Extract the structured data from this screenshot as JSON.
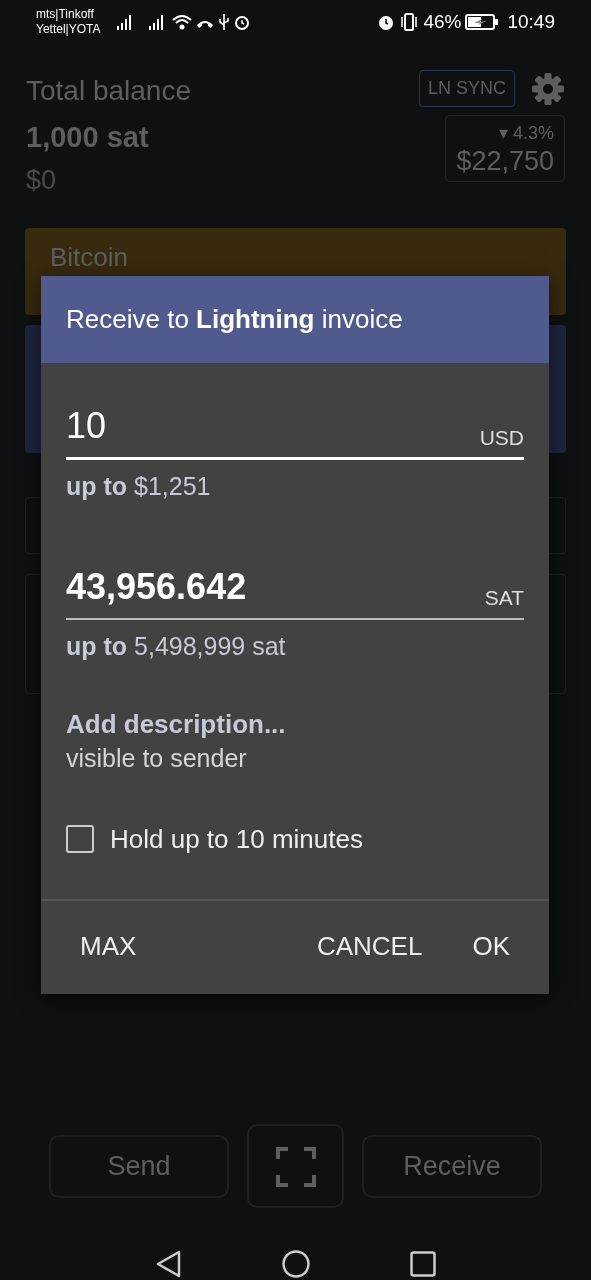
{
  "status_bar": {
    "carriers": [
      "mts|Tinkoff",
      "Yettel|YOTA"
    ],
    "battery": "46%",
    "time": "10:49"
  },
  "header": {
    "title": "Total balance",
    "balance": "1,000 sat",
    "fiat": "$0",
    "sync_button": "LN SYNC",
    "price_change": "▾ 4.3%",
    "price": "$22,750"
  },
  "accounts": [
    {
      "name": "Bitcoin",
      "color": "#382a0e"
    },
    {
      "color": "#1f2540"
    }
  ],
  "dialog": {
    "title": "Receive to **Lightning** invoice",
    "fields": [
      {
        "value": "10",
        "unit": "USD",
        "focused": true,
        "limit": "**up to** $1,251"
      },
      {
        "value": "43,956.642",
        "unit": "SAT",
        "focused": false,
        "limit": "**up to** 5,498,999 sat"
      }
    ],
    "description": {
      "label": "Add description...",
      "hint": "visible to sender"
    },
    "hold": {
      "label": "Hold up to 10 minutes",
      "checked": false
    },
    "buttons": [
      "MAX",
      "CANCEL",
      "OK"
    ]
  },
  "actions": {
    "send": "Send",
    "receive": "Receive"
  }
}
